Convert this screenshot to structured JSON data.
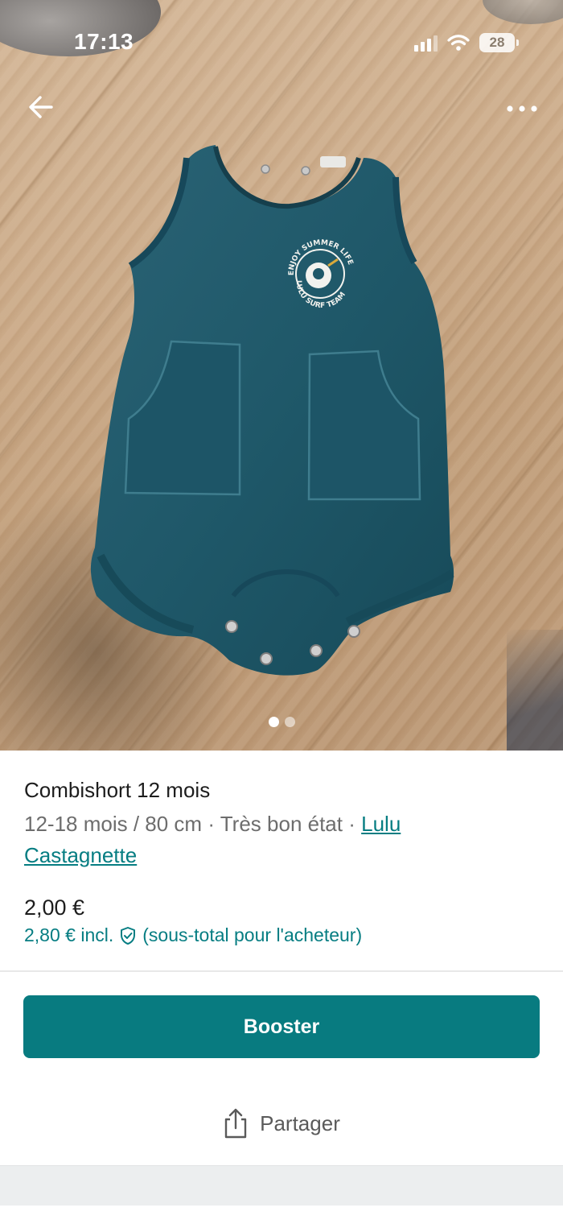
{
  "status_bar": {
    "time": "17:13",
    "battery": "28"
  },
  "nav": {
    "back_icon": "arrow-left-icon",
    "more_icon": "more-horizontal-icon"
  },
  "gallery": {
    "photo_count": 2,
    "active_index": 0,
    "print": {
      "top": "ENJOY SUMMER LIFE",
      "bottom": "LULU SURF TEAM"
    }
  },
  "item": {
    "title": "Combishort 12 mois",
    "size": "12-18 mois / 80 cm",
    "separator": "·",
    "condition": "Très bon état",
    "brand_part1": "Lulu",
    "brand_part2": "Castagnette",
    "price": "2,00 €",
    "price_incl": "2,80 € incl.",
    "price_incl_note": "(sous-total pour l'acheteur)"
  },
  "actions": {
    "booster_label": "Booster",
    "share_label": "Partager"
  },
  "colors": {
    "accent": "#087b80",
    "link": "#067d82",
    "text_primary": "#1d1d1d",
    "text_secondary": "#6d6d6d",
    "romper": "#1e5566"
  }
}
